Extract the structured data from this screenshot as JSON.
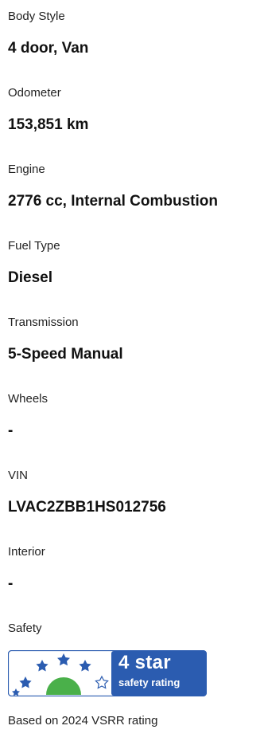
{
  "specs": [
    {
      "label": "Body Style",
      "value": "4 door, Van"
    },
    {
      "label": "Odometer",
      "value": "153,851 km"
    },
    {
      "label": "Engine",
      "value": "2776 cc, Internal Combustion"
    },
    {
      "label": "Fuel Type",
      "value": "Diesel"
    },
    {
      "label": "Transmission",
      "value": "5-Speed Manual"
    },
    {
      "label": "Wheels",
      "value": "-"
    },
    {
      "label": "VIN",
      "value": "LVAC2ZBB1HS012756"
    },
    {
      "label": "Interior",
      "value": "-"
    }
  ],
  "safety": {
    "label": "Safety",
    "badge_rating": "4 star",
    "badge_caption": "safety rating",
    "stars_filled": 4,
    "stars_total": 5,
    "based_on": "Based on 2024 VSRR rating",
    "colors": {
      "badge_bg": "#2b5cb0",
      "star_fill": "#2b5cb0",
      "dome": "#4ab04a",
      "text": "#ffffff"
    }
  }
}
